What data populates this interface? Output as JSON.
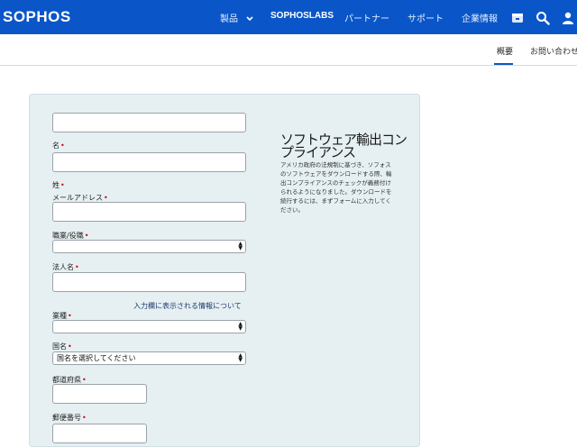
{
  "header": {
    "logo": "SOPHOS",
    "nav": [
      "製品",
      "SOPHOSLABS",
      "パートナー",
      "サポート",
      "企業情報"
    ],
    "brand_color": "#0a56c8"
  },
  "icons": {
    "store": "store-icon",
    "search": "search-icon",
    "user": "user-icon",
    "chevron": "chevron-down-icon"
  },
  "subnav": {
    "tabs": [
      "概要",
      "お問い合わせ"
    ],
    "active": "概要"
  },
  "form": {
    "first_name_label": "名",
    "last_name_label": "姓",
    "email_label": "メールアドレス",
    "job_label": "職業/役職",
    "company_label": "法人名",
    "info_link": "入力欄に表示される情報について",
    "industry_label": "業種",
    "country_label": "国名",
    "country_value": "国名を選択してください",
    "prefecture_label": "都道府県",
    "postal_label": "郵便番号",
    "required_mark": "•"
  },
  "sidebar": {
    "title": "ソフトウェア輸出コンプライアンス",
    "body": "アメリカ政府の法規制に基づき、ソフォスのソフトウェアをダウンロードする際、輸出コンプライアンスのチェックが義務付けられるようになりました。ダウンロードを続行するには、まずフォームに入力してください。"
  }
}
